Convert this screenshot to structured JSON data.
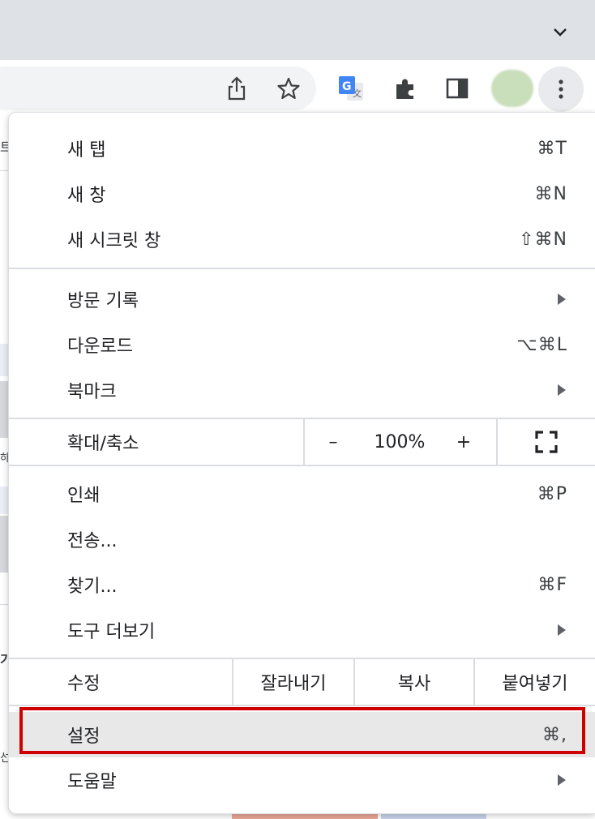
{
  "browser": {
    "icons": {
      "tab_dropdown": "chevron-down-icon",
      "share": "share-icon",
      "bookmark": "star-icon",
      "translate": "google-translate-icon",
      "extensions": "puzzle-icon",
      "side_panel": "side-panel-icon",
      "profile": "profile-avatar",
      "menu": "kebab-menu-icon"
    }
  },
  "background_page": {
    "glyphs": [
      "트",
      "하",
      "기",
      "선"
    ]
  },
  "menu": {
    "group1": [
      {
        "label": "새 탭",
        "shortcut": "⌘T"
      },
      {
        "label": "새 창",
        "shortcut": "⌘N"
      },
      {
        "label": "새 시크릿 창",
        "shortcut": "⇧⌘N"
      }
    ],
    "group2": [
      {
        "label": "방문 기록",
        "submenu": true
      },
      {
        "label": "다운로드",
        "shortcut": "⌥⌘L"
      },
      {
        "label": "북마크",
        "submenu": true
      }
    ],
    "zoom": {
      "label": "확대/축소",
      "minus": "–",
      "value": "100%",
      "plus": "+",
      "fullscreen_icon": "fullscreen-icon"
    },
    "group3": [
      {
        "label": "인쇄",
        "shortcut": "⌘P"
      },
      {
        "label": "전송...",
        "shortcut": ""
      },
      {
        "label": "찾기...",
        "shortcut": "⌘F"
      },
      {
        "label": "도구 더보기",
        "submenu": true
      }
    ],
    "edit": {
      "label": "수정",
      "cut": "잘라내기",
      "copy": "복사",
      "paste": "붙여넣기"
    },
    "settings": {
      "label": "설정",
      "shortcut": "⌘,"
    },
    "help": {
      "label": "도움말",
      "submenu": true
    }
  },
  "colors": {
    "highlight_border": "#d10000",
    "hover_background": "#e8e8e8"
  }
}
